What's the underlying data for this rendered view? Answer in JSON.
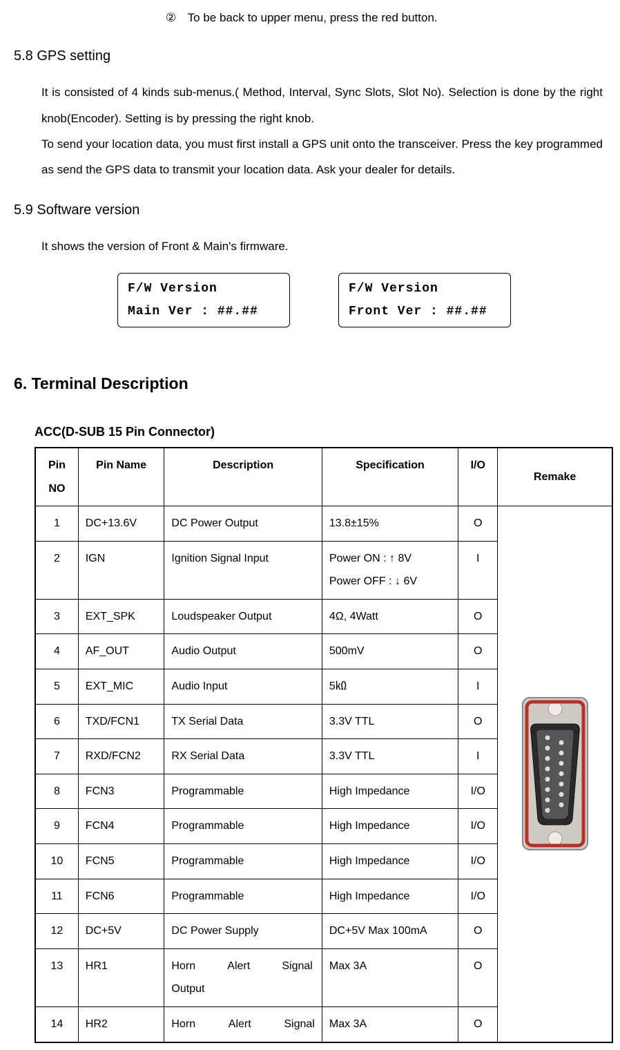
{
  "num_item": {
    "num": "②",
    "text": "To be back to upper menu, press the red button."
  },
  "sec58": {
    "heading": "5.8 GPS setting",
    "p1": "It is consisted of 4 kinds sub-menus.( Method, Interval, Sync Slots, Slot No). Selection is done by the right knob(Encoder). Setting is by pressing the right knob.",
    "p2": "To send your location data, you must first install a GPS unit onto the transceiver. Press the key programmed as send the GPS data to transmit your location data. Ask your dealer for details."
  },
  "sec59": {
    "heading": "5.9 Software version",
    "p1": "It shows the version of Front & Main's firmware."
  },
  "lcd1": {
    "line1": "F/W Version",
    "line2": "Main Ver : ##.##"
  },
  "lcd2": {
    "line1": "F/W Version",
    "line2": "Front Ver : ##.##"
  },
  "chapter6": "6. Terminal Description",
  "table_title": "ACC(D-SUB 15 Pin Connector)",
  "headers": {
    "pinno": "Pin NO",
    "pinname": "Pin Name",
    "desc": "Description",
    "spec": "Specification",
    "io": "I/O",
    "remake": "Remake"
  },
  "rows": [
    {
      "no": "1",
      "name": "DC+13.6V",
      "desc": "DC Power Output",
      "spec": "13.8±15%",
      "io": "O"
    },
    {
      "no": "2",
      "name": "IGN",
      "desc": "Ignition Signal Input",
      "spec": "Power ON : ↑ 8V\nPower OFF : ↓ 6V",
      "io": "I"
    },
    {
      "no": "3",
      "name": "EXT_SPK",
      "desc": "Loudspeaker Output",
      "spec": "4Ω, 4Watt",
      "io": "O"
    },
    {
      "no": "4",
      "name": "AF_OUT",
      "desc": "Audio Output",
      "spec": "500mV",
      "io": "O"
    },
    {
      "no": "5",
      "name": "EXT_MIC",
      "desc": "Audio Input",
      "spec": "5㏀",
      "io": "I"
    },
    {
      "no": "6",
      "name": "TXD/FCN1",
      "desc": "TX Serial Data",
      "spec": "3.3V TTL",
      "io": "O"
    },
    {
      "no": "7",
      "name": "RXD/FCN2",
      "desc": "RX Serial Data",
      "spec": "3.3V TTL",
      "io": "I"
    },
    {
      "no": "8",
      "name": "FCN3",
      "desc": "Programmable",
      "spec": "High Impedance",
      "io": "I/O"
    },
    {
      "no": "9",
      "name": "FCN4",
      "desc": "Programmable",
      "spec": "High Impedance",
      "io": "I/O"
    },
    {
      "no": "10",
      "name": "FCN5",
      "desc": "Programmable",
      "spec": "High Impedance",
      "io": "I/O"
    },
    {
      "no": "11",
      "name": "FCN6",
      "desc": "Programmable",
      "spec": "High Impedance",
      "io": "I/O"
    },
    {
      "no": "12",
      "name": "DC+5V",
      "desc": "DC Power Supply",
      "spec": "DC+5V Max 100mA",
      "io": "O"
    },
    {
      "no": "13",
      "name": "HR1",
      "desc": "Horn Alert Signal Output",
      "spec": "Max 3A",
      "io": "O",
      "justify": true
    },
    {
      "no": "14",
      "name": "HR2",
      "desc": "Horn Alert Signal",
      "spec": "Max 3A",
      "io": "O",
      "justify": true
    }
  ]
}
